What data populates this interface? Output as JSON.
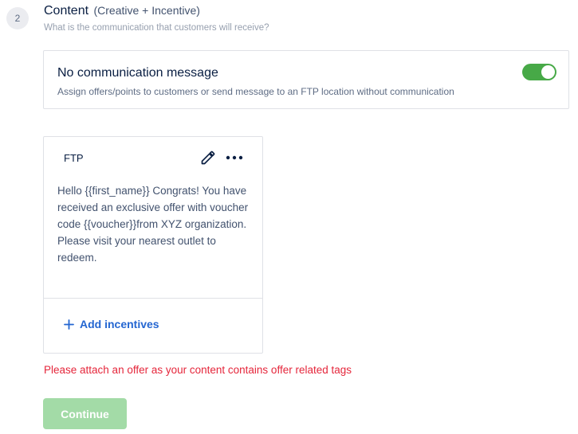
{
  "step": {
    "number": "2",
    "title": "Content",
    "subtitle": "(Creative + Incentive)",
    "description": "What is the communication that customers will receive?"
  },
  "no_communication": {
    "title": "No communication message",
    "description": "Assign offers/points to customers or send message to an FTP location without communication",
    "toggle_on": true
  },
  "ftp_card": {
    "label": "FTP",
    "message": "Hello {{first_name}} Congrats! You have received an exclusive offer with voucher code {{voucher}}from XYZ organization. Please visit your nearest outlet to redeem.",
    "edit_icon": "pencil-icon",
    "more_icon": "more-horizontal-icon",
    "add_incentives_label": "Add incentives",
    "add_icon": "plus-icon"
  },
  "error_message": "Please attach an offer as your content contains offer related tags",
  "continue_label": "Continue",
  "colors": {
    "toggle_on": "#47a947",
    "link_blue": "#2466d1",
    "error_red": "#e5263b",
    "continue_disabled": "#a3dba7"
  }
}
